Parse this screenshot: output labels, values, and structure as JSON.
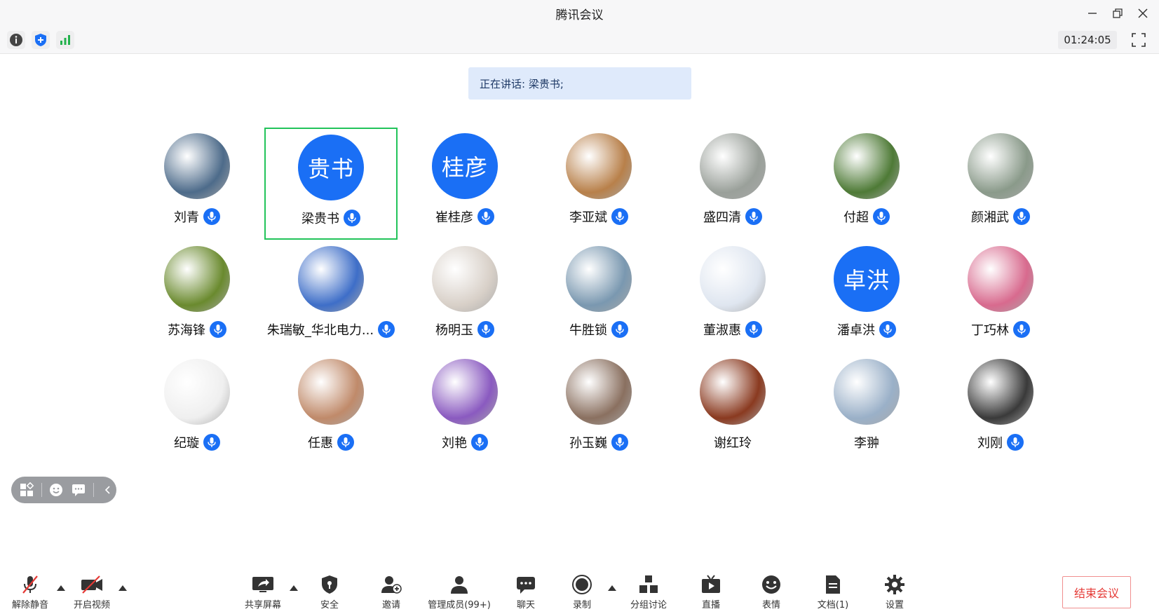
{
  "window": {
    "title": "腾讯会议"
  },
  "toolbar": {
    "timer": "01:24:05"
  },
  "speaking": {
    "text": "正在讲话: 梁贵书;"
  },
  "participants": [
    {
      "name": "刘青",
      "avatar_text": "",
      "mic": true,
      "active": false
    },
    {
      "name": "梁贵书",
      "avatar_text": "贵书",
      "mic": true,
      "active": true
    },
    {
      "name": "崔桂彦",
      "avatar_text": "桂彦",
      "mic": true,
      "active": false
    },
    {
      "name": "李亚斌",
      "avatar_text": "",
      "mic": true,
      "active": false
    },
    {
      "name": "盛四清",
      "avatar_text": "",
      "mic": true,
      "active": false
    },
    {
      "name": "付超",
      "avatar_text": "",
      "mic": true,
      "active": false
    },
    {
      "name": "颜湘武",
      "avatar_text": "",
      "mic": true,
      "active": false
    },
    {
      "name": "苏海锋",
      "avatar_text": "",
      "mic": true,
      "active": false
    },
    {
      "name": "朱瑞敏_华北电力...",
      "avatar_text": "",
      "mic": true,
      "active": false
    },
    {
      "name": "杨明玉",
      "avatar_text": "",
      "mic": true,
      "active": false
    },
    {
      "name": "牛胜锁",
      "avatar_text": "",
      "mic": true,
      "active": false
    },
    {
      "name": "董淑惠",
      "avatar_text": "",
      "mic": true,
      "active": false
    },
    {
      "name": "潘卓洪",
      "avatar_text": "卓洪",
      "mic": true,
      "active": false
    },
    {
      "name": "丁巧林",
      "avatar_text": "",
      "mic": true,
      "active": false
    },
    {
      "name": "纪璇",
      "avatar_text": "",
      "mic": true,
      "active": false
    },
    {
      "name": "任惠",
      "avatar_text": "",
      "mic": true,
      "active": false
    },
    {
      "name": "刘艳",
      "avatar_text": "",
      "mic": true,
      "active": false
    },
    {
      "name": "孙玉巍",
      "avatar_text": "",
      "mic": true,
      "active": false
    },
    {
      "name": "谢红玲",
      "avatar_text": "",
      "mic": false,
      "active": false
    },
    {
      "name": "李翀",
      "avatar_text": "",
      "mic": false,
      "active": false
    },
    {
      "name": "刘刚",
      "avatar_text": "",
      "mic": true,
      "active": false
    }
  ],
  "bottom_bar": {
    "unmute": "解除静音",
    "start_video": "开启视频",
    "share_screen": "共享屏幕",
    "security": "安全",
    "invite": "邀请",
    "manage_members": "管理成员(99+)",
    "chat": "聊天",
    "record": "录制",
    "breakout": "分组讨论",
    "live": "直播",
    "reactions": "表情",
    "docs": "文档(1)",
    "settings": "设置",
    "end_meeting": "结束会议"
  },
  "colors": {
    "accent": "#1a6ff5",
    "active_border": "#22c35a",
    "end": "#e53935"
  }
}
